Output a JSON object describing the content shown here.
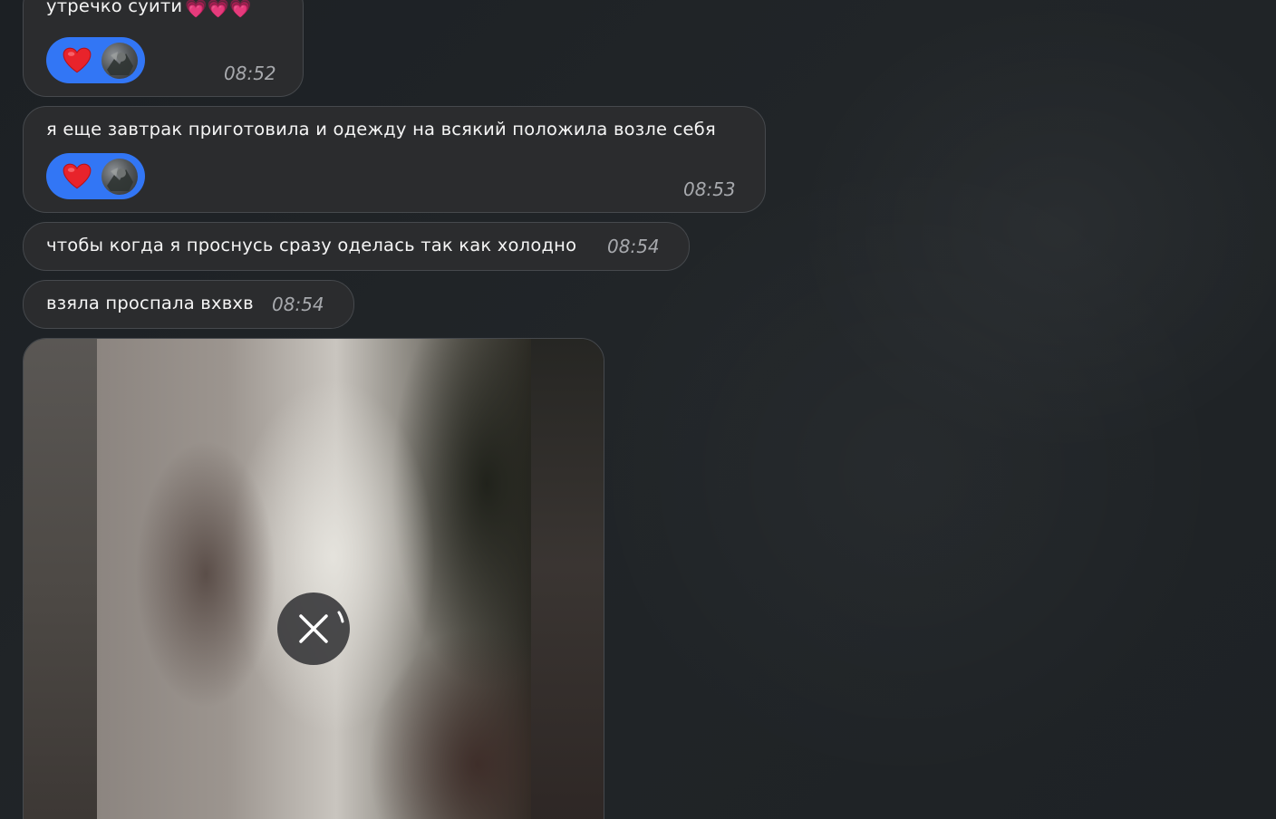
{
  "messages": [
    {
      "text": "утречко суити",
      "emoji": "💗💗💗",
      "time": "08:52",
      "reaction": {
        "emoji": "heart-icon",
        "color": "#3276f5"
      }
    },
    {
      "text": "я еще завтрак приготовила и одежду на всякий положила возле себя",
      "time": "08:53",
      "reaction": {
        "emoji": "heart-icon",
        "color": "#3276f5"
      }
    },
    {
      "text": "чтобы когда я проснусь сразу оделась так как холодно",
      "time": "08:54"
    },
    {
      "text": "взяла проспала вхвхв",
      "time": "08:54"
    }
  ],
  "photo_message": {
    "status": "loading",
    "control_icon": "cancel-download-icon"
  },
  "colors": {
    "bubble": "#2b2c2e",
    "bubble_border": "#46494d",
    "reaction_pill": "#3276f5",
    "time_text": "#a7a9ad"
  }
}
